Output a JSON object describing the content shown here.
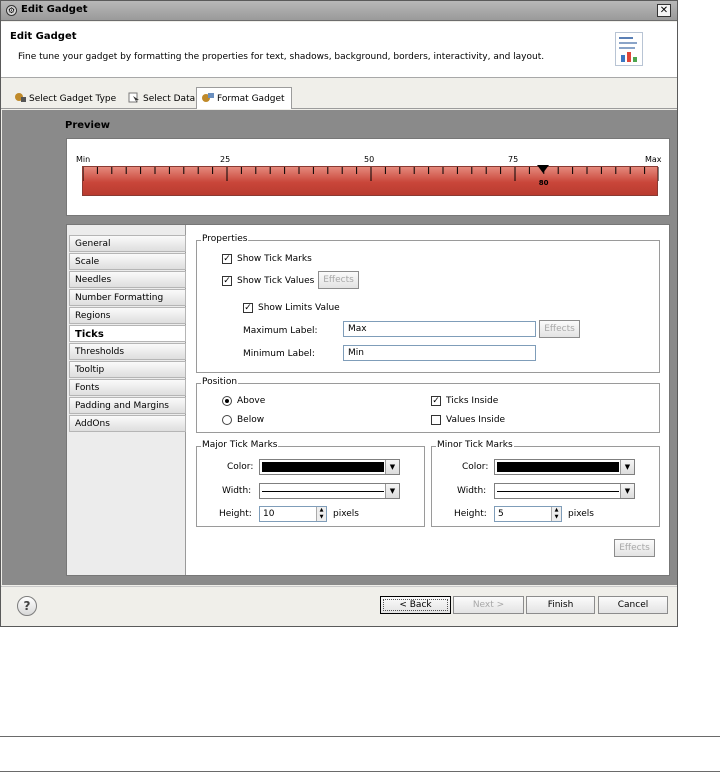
{
  "window": {
    "title": "Edit Gadget",
    "close_glyph": "✕"
  },
  "banner": {
    "heading": "Edit Gadget",
    "description": "Fine tune your gadget by formatting the properties for text, shadows, background, borders, interactivity, and layout."
  },
  "tabs": [
    {
      "label": "Select Gadget Type",
      "icon": "gadget-type-icon"
    },
    {
      "label": "Select Data",
      "icon": "select-data-icon"
    },
    {
      "label": "Format Gadget",
      "icon": "format-gadget-icon",
      "active": true
    }
  ],
  "preview": {
    "label": "Preview",
    "scale_labels": [
      "Min",
      "25",
      "50",
      "75",
      "Max"
    ],
    "needle_value": "80",
    "scale_min": 0,
    "scale_max": 100,
    "needle_fraction": 0.8,
    "bar_color": "#c9463a"
  },
  "nav": {
    "items": [
      {
        "label": "General"
      },
      {
        "label": "Scale"
      },
      {
        "label": "Needles"
      },
      {
        "label": "Number Formatting"
      },
      {
        "label": "Regions"
      },
      {
        "label": "Ticks",
        "active": true
      },
      {
        "label": "Thresholds"
      },
      {
        "label": "Tooltip"
      },
      {
        "label": "Fonts"
      },
      {
        "label": "Padding and Margins"
      },
      {
        "label": "AddOns"
      }
    ]
  },
  "properties": {
    "group_label": "Properties",
    "show_tick_marks": {
      "label": "Show Tick Marks",
      "checked": true
    },
    "show_tick_values": {
      "label": "Show Tick Values",
      "checked": true
    },
    "effects_label": "Effects",
    "show_limits_value": {
      "label": "Show Limits Value",
      "checked": true
    },
    "maximum_label": {
      "label": "Maximum Label:",
      "value": "Max"
    },
    "minimum_label": {
      "label": "Minimum Label:",
      "value": "Min"
    }
  },
  "position": {
    "group_label": "Position",
    "above": {
      "label": "Above",
      "selected": true
    },
    "below": {
      "label": "Below",
      "selected": false
    },
    "ticks_inside": {
      "label": "Ticks Inside",
      "checked": true
    },
    "values_inside": {
      "label": "Values Inside",
      "checked": false
    }
  },
  "major": {
    "group_label": "Major Tick Marks",
    "color_label": "Color:",
    "width_label": "Width:",
    "height_label": "Height:",
    "height_value": "10",
    "units": "pixels",
    "color": "#000000"
  },
  "minor": {
    "group_label": "Minor Tick Marks",
    "color_label": "Color:",
    "width_label": "Width:",
    "height_label": "Height:",
    "height_value": "5",
    "units": "pixels",
    "color": "#000000"
  },
  "effects_bottom": "Effects",
  "footer": {
    "help_glyph": "?",
    "back": "< Back",
    "next": "Next >",
    "finish": "Finish",
    "cancel": "Cancel"
  }
}
